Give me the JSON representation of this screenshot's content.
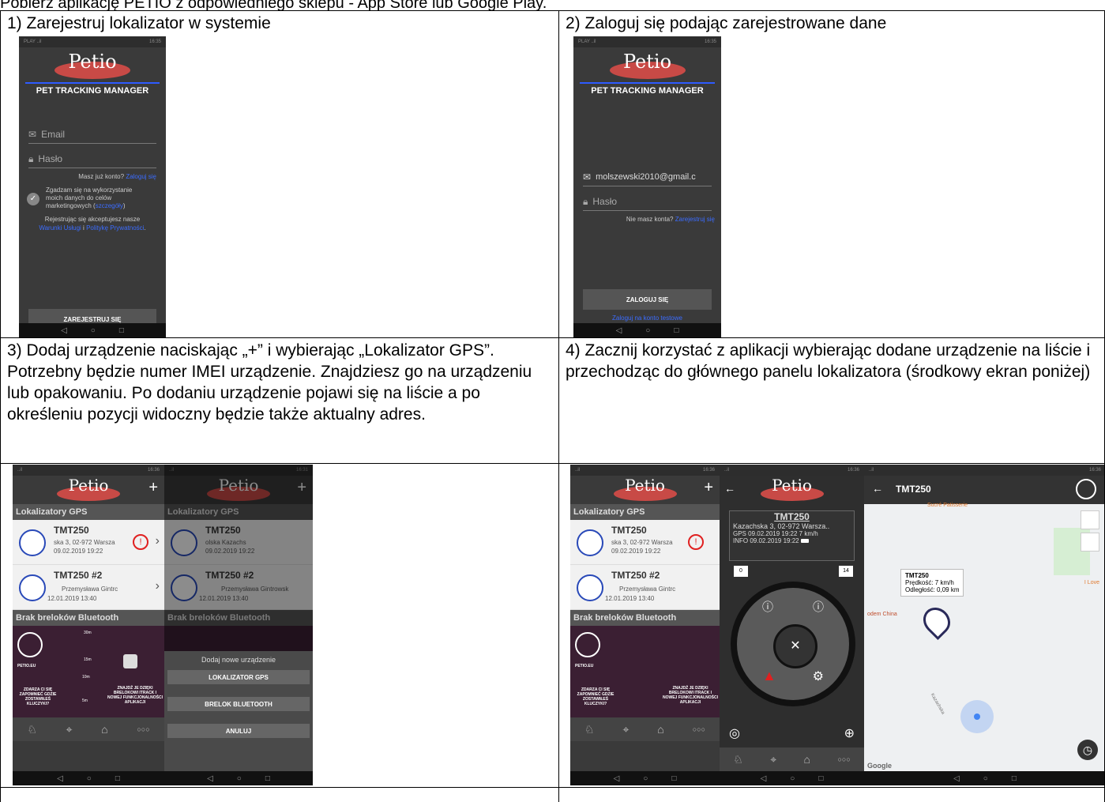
{
  "top_text": "Pobierz aplikację PETIO z odpowiedniego sklepu - App Store lub Google Play.",
  "steps": [
    {
      "caption": "1) Zarejestruj lokalizator w systemie"
    },
    {
      "caption": "2) Zaloguj się podając zarejestrowane dane"
    },
    {
      "caption": "3) Dodaj urządzenie naciskając „+” i wybierając „Lokalizator GPS”. Potrzebny będzie numer IMEI urządzenie. Znajdziesz go na urządzeniu lub opakowaniu. Po dodaniu urządzenie pojawi się na liście a po określeniu pozycji widoczny będzie także aktualny adres."
    },
    {
      "caption": "4) Zacznij korzystać z aplikacji wybierając dodane urządzenie na liście i przechodząc do głównego panelu lokalizatora (środkowy ekran poniżej)"
    }
  ],
  "app": {
    "logo": "Petio",
    "subtitle": "PET TRACKING MANAGER",
    "nav_icons": [
      "back-triangle-icon",
      "home-circle-icon",
      "recents-square-icon"
    ]
  },
  "register": {
    "email_placeholder": "Email",
    "password_placeholder": "Hasło",
    "have_account": "Masz już konto?",
    "login_link": "Zaloguj się",
    "consent_a": "Zgadzam się na wykorzystanie",
    "consent_b": "moich danych do celów",
    "consent_c": "marketingowych (",
    "consent_link": "szczegóły",
    "consent_end": ")",
    "terms_a": "Rejestrując się akceptujesz nasze",
    "terms_link1": "Warunki Usługi",
    "terms_and": " i ",
    "terms_link2": "Politykę Prywatności",
    "terms_end": ".",
    "button": "ZAREJESTRUJ SIĘ"
  },
  "login": {
    "email_value": "molszewski2010@gmail.c",
    "password_placeholder": "Hasło",
    "no_account": "Nie masz konta?",
    "register_link": "Zarejestruj się",
    "button": "ZALOGUJ SIĘ",
    "test_link": "Zaloguj na konto testowe"
  },
  "devices": {
    "plus": "+",
    "gps_section": "Lokalizatory GPS",
    "bt_section": "Brak breloków Bluetooth",
    "items": [
      {
        "name": "TMT250",
        "address": "ska 3, 02-972 Warsza",
        "address_alt": "olska Kazachs",
        "date": "09.02.2019 19:22"
      },
      {
        "name": "TMT250 #2",
        "address": "Przemysława Gintrc",
        "address_alt": "Przemysława Gintrowsk",
        "date": "12.01.2019 13:40"
      }
    ],
    "banner_brand": "PETIO.EU",
    "banner_left": "ZDARZA CI SIĘ ZAPOMNIEĆ GDZIE ZOSTAWIŁEŚ KLUCZYKI?",
    "banner_right": "ZNAJDŹ JE DZIĘKI BRELOKOWI ITRACK I NOWEJ FUNKCJONALNOŚCI APLIKACJI",
    "dist_labels": [
      "30m",
      "15m",
      "10m",
      "5m"
    ],
    "modal_title": "Dodaj nowe urządzenie",
    "modal_gps": "LOKALIZATOR GPS",
    "modal_bt": "BRELOK BLUETOOTH",
    "modal_cancel": "ANULUJ",
    "more": "○○○"
  },
  "panel": {
    "name": "TMT250",
    "address": "Kazachska 3, 02-972 Warsza..",
    "gps_label": "GPS",
    "gps_value": "09.02.2019 19:22  7 km/h",
    "info_label": "INFO",
    "info_value": "09.02.2019 19:22",
    "left_badge": "0",
    "right_badge": "14"
  },
  "map": {
    "title": "TMT250",
    "tip_name": "TMT250",
    "tip_speed": "Prędkość: 7 km/h",
    "tip_dist": "Odległość: 0,09 km",
    "poi1": "Sucré Patisserie",
    "poi2": "odem China",
    "poi3": "I Love",
    "street": "Kazachska",
    "google": "Google"
  }
}
